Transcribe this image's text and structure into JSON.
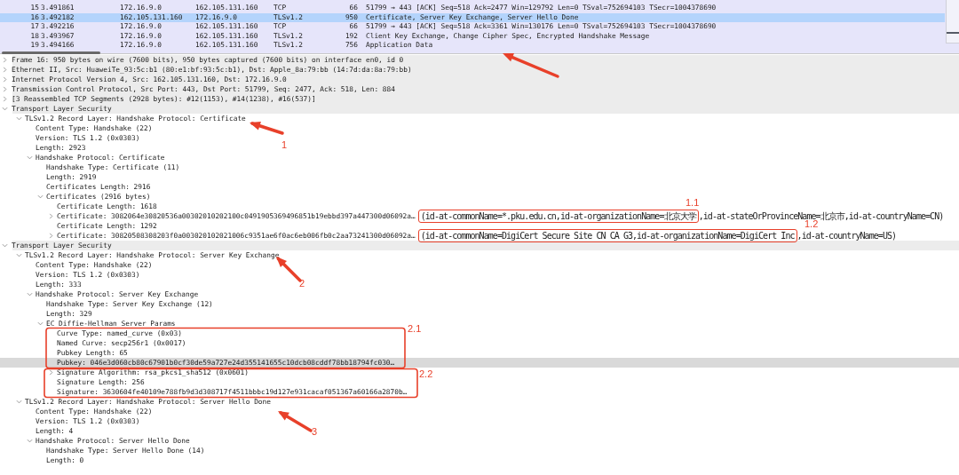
{
  "packets": [
    {
      "no": "15",
      "time": "3.491861",
      "source": "172.16.9.0",
      "destination": "162.105.131.160",
      "protocol": "TCP",
      "length": "66",
      "info": "51799 → 443 [ACK] Seq=518 Ack=2477 Win=129792 Len=0 TSval=752694103 TSecr=1004378690",
      "selected": false
    },
    {
      "no": "16",
      "time": "3.492182",
      "source": "162.105.131.160",
      "destination": "172.16.9.0",
      "protocol": "TLSv1.2",
      "length": "950",
      "info": "Certificate, Server Key Exchange, Server Hello Done",
      "selected": true
    },
    {
      "no": "17",
      "time": "3.492216",
      "source": "172.16.9.0",
      "destination": "162.105.131.160",
      "protocol": "TCP",
      "length": "66",
      "info": "51799 → 443 [ACK] Seq=518 Ack=3361 Win=130176 Len=0 TSval=752694103 TSecr=1004378690",
      "selected": false
    },
    {
      "no": "18",
      "time": "3.493967",
      "source": "172.16.9.0",
      "destination": "162.105.131.160",
      "protocol": "TLSv1.2",
      "length": "192",
      "info": "Client Key Exchange, Change Cipher Spec, Encrypted Handshake Message",
      "selected": false
    },
    {
      "no": "19",
      "time": "3.494166",
      "source": "172.16.9.0",
      "destination": "162.105.131.160",
      "protocol": "TLSv1.2",
      "length": "756",
      "info": "Application Data",
      "selected": false
    }
  ],
  "details": [
    {
      "text": "Frame 16: 950 bytes on wire (7600 bits), 950 bytes captured (7600 bits) on interface en0, id 0",
      "expanded": false
    },
    {
      "text": "Ethernet II, Src: HuaweiTe_93:5c:b1 (80:e1:bf:93:5c:b1), Dst: Apple_8a:79:bb (14:7d:da:8a:79:bb)",
      "expanded": false
    },
    {
      "text": "Internet Protocol Version 4, Src: 162.105.131.160, Dst: 172.16.9.0",
      "expanded": false
    },
    {
      "text": "Transmission Control Protocol, Src Port: 443, Dst Port: 51799, Seq: 2477, Ack: 518, Len: 884",
      "expanded": false
    },
    {
      "text": "[3 Reassembled TCP Segments (2928 bytes): #12(1153), #14(1238), #16(537)]",
      "expanded": false
    },
    {
      "text": "Transport Layer Security",
      "expanded": true,
      "children": [
        {
          "text": "TLSv1.2 Record Layer: Handshake Protocol: Certificate",
          "expanded": true,
          "children": [
            {
              "text": "Content Type: Handshake (22)"
            },
            {
              "text": "Version: TLS 1.2 (0x0303)"
            },
            {
              "text": "Length: 2923"
            },
            {
              "text": "Handshake Protocol: Certificate",
              "expanded": true,
              "children": [
                {
                  "text": "Handshake Type: Certificate (11)"
                },
                {
                  "text": "Length: 2919"
                },
                {
                  "text": "Certificates Length: 2916"
                },
                {
                  "text": "Certificates (2916 bytes)",
                  "expanded": true,
                  "children": [
                    {
                      "text": "Certificate Length: 1618"
                    },
                    {
                      "text": "Certificate: 3082064e30820536a00302010202100c0491905369496851b19ebbd397a447300d06092a…",
                      "subject": [
                        "(id-at-commonName=*.pku.edu.cn,id-at-organizationName=北京大学",
                        ",id-at-stateOrProvinceName=北京市,id-at-countryName=CN)"
                      ],
                      "expanded": false
                    },
                    {
                      "text": "Certificate Length: 1292"
                    },
                    {
                      "text": "Certificate: 30820508308203f0a003020102021006c9351ae6f0ac6eb006fb0c2aa73241300d06092a…",
                      "subject": [
                        "(id-at-commonName=DigiCert Secure Site CN CA G3,id-at-organizationName=DigiCert Inc",
                        ",id-at-countryName=US)"
                      ],
                      "expanded": false
                    }
                  ]
                }
              ]
            }
          ]
        }
      ]
    },
    {
      "text": "Transport Layer Security",
      "expanded": true,
      "children": [
        {
          "text": "TLSv1.2 Record Layer: Handshake Protocol: Server Key Exchange",
          "expanded": true,
          "children": [
            {
              "text": "Content Type: Handshake (22)"
            },
            {
              "text": "Version: TLS 1.2 (0x0303)"
            },
            {
              "text": "Length: 333"
            },
            {
              "text": "Handshake Protocol: Server Key Exchange",
              "expanded": true,
              "children": [
                {
                  "text": "Handshake Type: Server Key Exchange (12)"
                },
                {
                  "text": "Length: 329"
                },
                {
                  "text": "EC Diffie-Hellman Server Params",
                  "expanded": true,
                  "children": [
                    {
                      "text": "Curve Type: named_curve (0x03)"
                    },
                    {
                      "text": "Named Curve: secp256r1 (0x0017)"
                    },
                    {
                      "text": "Pubkey Length: 65"
                    },
                    {
                      "text": "Pubkey: 046e3d060cb80c67901b0cf30de59a727e24d355141655c10dcb08cddf78bb18794fc030…",
                      "selected": true
                    },
                    {
                      "text": "Signature Algorithm: rsa_pkcs1_sha512 (0x0601)",
                      "expanded": false
                    },
                    {
                      "text": "Signature Length: 256"
                    },
                    {
                      "text": "Signature: 3630604fe40109e788fb9d3d308717f4511bbbc19d127e931cacaf051367a60166a2870b…"
                    }
                  ]
                }
              ]
            }
          ]
        },
        {
          "text": "TLSv1.2 Record Layer: Handshake Protocol: Server Hello Done",
          "expanded": true,
          "children": [
            {
              "text": "Content Type: Handshake (22)"
            },
            {
              "text": "Version: TLS 1.2 (0x0303)"
            },
            {
              "text": "Length: 4"
            },
            {
              "text": "Handshake Protocol: Server Hello Done",
              "expanded": true,
              "children": [
                {
                  "text": "Handshake Type: Server Hello Done (14)"
                },
                {
                  "text": "Length: 0"
                }
              ]
            }
          ]
        }
      ]
    }
  ],
  "annotations": [
    {
      "kind": "arrow"
    },
    {
      "kind": "arrow",
      "label": "1"
    },
    {
      "kind": "inline-box",
      "label": "1.1"
    },
    {
      "kind": "inline-box",
      "label": "1.2"
    },
    {
      "kind": "arrow",
      "label": "2"
    },
    {
      "kind": "box",
      "label": "2.1"
    },
    {
      "kind": "box",
      "label": "2.2"
    },
    {
      "kind": "arrow",
      "label": "3"
    }
  ]
}
